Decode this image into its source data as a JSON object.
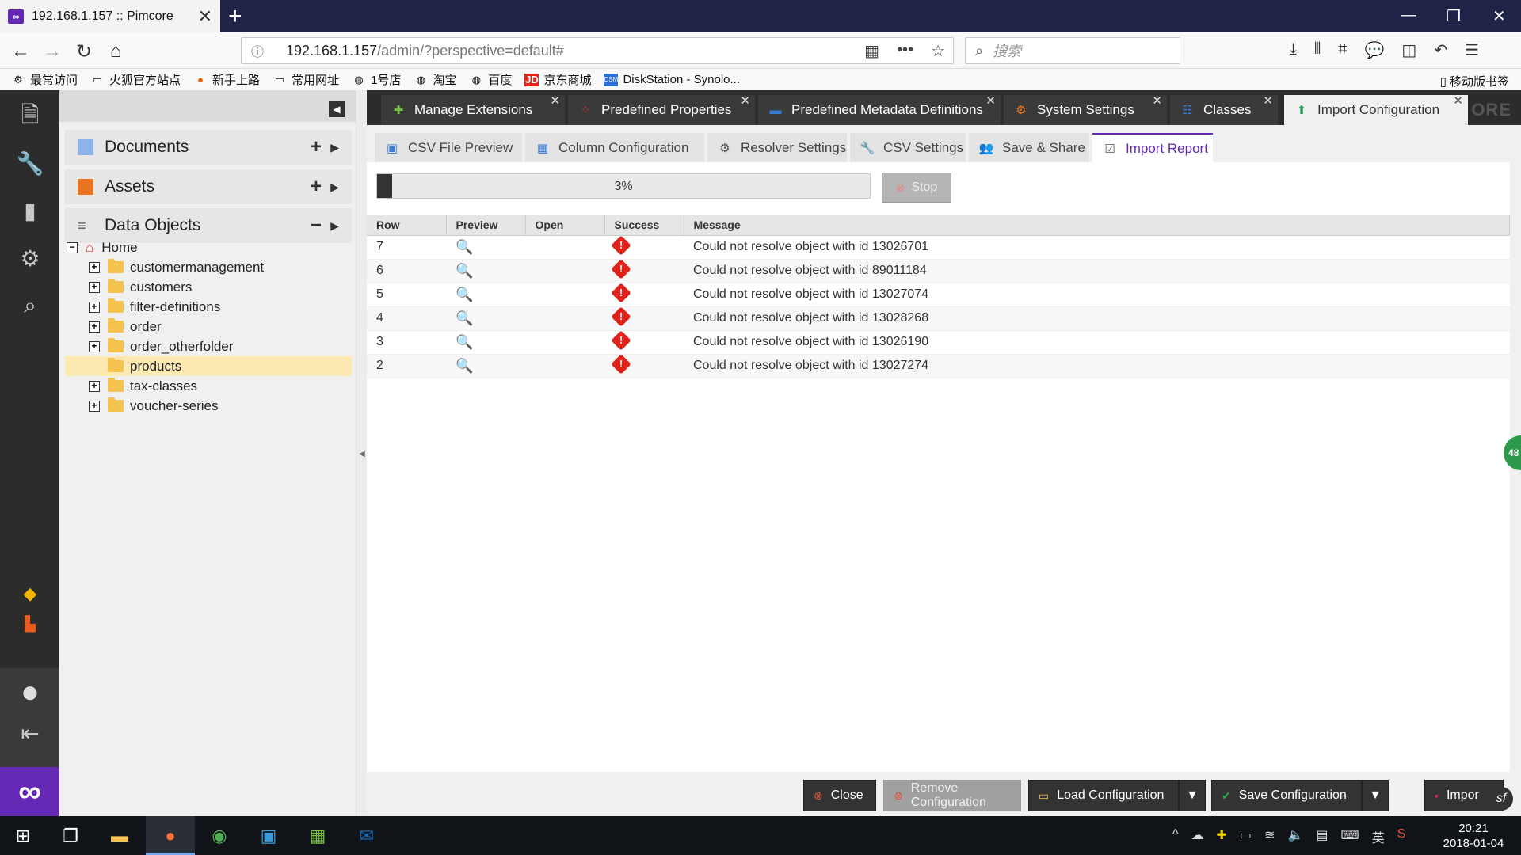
{
  "browser": {
    "tab_title": "192.168.1.157 :: Pimcore",
    "tab_close": "✕",
    "new_tab": "+",
    "url_host": "192.168.1.157",
    "url_path": "/admin/?perspective=default#",
    "search_placeholder": "搜索",
    "bookmarks": [
      "最常访问",
      "火狐官方站点",
      "新手上路",
      "常用网址",
      "1号店",
      "淘宝",
      "百度",
      "京东商城",
      "DiskStation - Synolo..."
    ],
    "mobile_bookmarks": "移动版书签"
  },
  "tree": {
    "documents": "Documents",
    "assets": "Assets",
    "data_objects": "Data Objects",
    "home": "Home",
    "nodes": [
      "customermanagement",
      "customers",
      "filter-definitions",
      "order",
      "order_otherfolder",
      "products",
      "tax-classes",
      "voucher-series"
    ],
    "selected": "products"
  },
  "top_tabs": [
    "Manage Extensions",
    "Predefined Properties",
    "Predefined Metadata Definitions",
    "System Settings",
    "Classes",
    "Import Configuration"
  ],
  "brand_text": "ORE",
  "sub_tabs": [
    "CSV File Preview",
    "Column Configuration",
    "Resolver Settings",
    "CSV Settings",
    "Save & Share",
    "Import Report"
  ],
  "progress": {
    "value": 0.03,
    "label": "3%"
  },
  "stop_label": "Stop",
  "grid": {
    "columns": [
      "Row",
      "Preview",
      "Open",
      "Success",
      "Message"
    ],
    "rows": [
      {
        "row": "7",
        "message": "Could not resolve object with id 13026701"
      },
      {
        "row": "6",
        "message": "Could not resolve object with id 89011184"
      },
      {
        "row": "5",
        "message": "Could not resolve object with id 13027074"
      },
      {
        "row": "4",
        "message": "Could not resolve object with id 13028268"
      },
      {
        "row": "3",
        "message": "Could not resolve object with id 13026190"
      },
      {
        "row": "2",
        "message": "Could not resolve object with id 13027274"
      }
    ]
  },
  "footer": {
    "close": "Close",
    "remove": "Remove Configuration",
    "load": "Load Configuration",
    "save": "Save Configuration",
    "import": "Impor"
  },
  "side_badge": "48",
  "clock": {
    "time": "20:21",
    "date": "2018-01-04"
  },
  "ime": "英"
}
